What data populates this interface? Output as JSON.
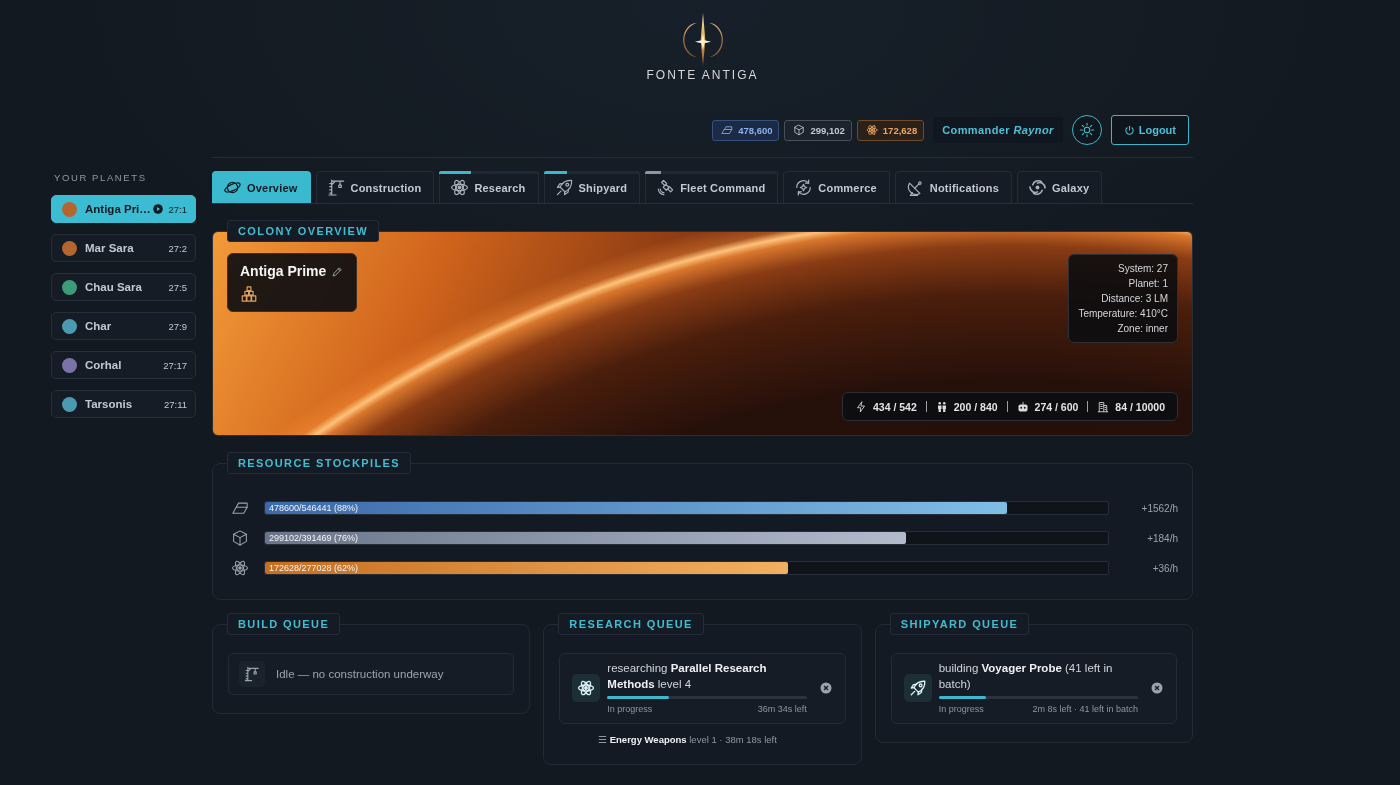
{
  "brand": {
    "name": "FONTE ANTIGA"
  },
  "resources": [
    {
      "kind": "ingot",
      "value": "478,600"
    },
    {
      "kind": "cube",
      "value": "299,102"
    },
    {
      "kind": "atom",
      "value": "172,628"
    }
  ],
  "user": {
    "text": "Commander *Raynor*"
  },
  "logout": {
    "label": "Logout"
  },
  "sidebar": {
    "title": "YOUR PLANETS",
    "planets": [
      {
        "name": "Antiga Pri…",
        "coords": "27:1",
        "color": "#b5652f",
        "selected": true,
        "active": true
      },
      {
        "name": "Mar Sara",
        "coords": "27:2",
        "color": "#b5652f",
        "selected": false,
        "active": false
      },
      {
        "name": "Chau Sara",
        "coords": "27:5",
        "color": "#3e9a78",
        "selected": false,
        "active": false
      },
      {
        "name": "Char",
        "coords": "27:9",
        "color": "#4a9bb0",
        "selected": false,
        "active": false
      },
      {
        "name": "Corhal",
        "coords": "27:17",
        "color": "#7b72a6",
        "selected": false,
        "active": false
      },
      {
        "name": "Tarsonis",
        "coords": "27:11",
        "color": "#4a9bb0",
        "selected": false,
        "active": false
      }
    ]
  },
  "tabs": [
    {
      "kind": "planet",
      "label": "Overview",
      "selected": true
    },
    {
      "kind": "crane",
      "label": "Construction",
      "selected": false
    },
    {
      "kind": "atom",
      "label": "Research",
      "selected": false,
      "level": 0.32,
      "color": "#3bb8cc"
    },
    {
      "kind": "rocket",
      "label": "Shipyard",
      "selected": false,
      "level": 0.24,
      "color": "#3bb8cc"
    },
    {
      "kind": "satellite",
      "label": "Fleet Command",
      "selected": false,
      "level": 0.12,
      "color": "#8c96a2"
    },
    {
      "kind": "cycle",
      "label": "Commerce",
      "selected": false
    },
    {
      "kind": "dish",
      "label": "Notifications",
      "selected": false
    },
    {
      "kind": "swirl",
      "label": "Galaxy",
      "selected": false
    }
  ],
  "colony": {
    "heading": "COLONY OVERVIEW",
    "name": "Antiga Prime",
    "details": [
      "System: 27",
      "Planet: 1",
      "Distance: 3 LM",
      "Temperature: 410°C",
      "Zone: inner"
    ],
    "stats": [
      {
        "kind": "bolt",
        "value": "434 / 542"
      },
      {
        "kind": "people",
        "value": "200 / 840"
      },
      {
        "kind": "robot",
        "value": "274 / 600"
      },
      {
        "kind": "building",
        "value": "84 / 10000"
      }
    ]
  },
  "stockpiles": {
    "heading": "RESOURCE STOCKPILES",
    "rows": [
      {
        "kind": "ingot",
        "amount": "478600/546441 (88%)",
        "level": 0.88,
        "rate": "+1562/h"
      },
      {
        "kind": "cube",
        "amount": "299102/391469 (76%)",
        "level": 0.76,
        "rate": "+184/h"
      },
      {
        "kind": "atom",
        "amount": "172628/277028 (62%)",
        "level": 0.62,
        "rate": "+36/h"
      }
    ]
  },
  "queues": [
    {
      "kind": "crane",
      "heading": "BUILD QUEUE",
      "idle": "Idle — no construction underway"
    },
    {
      "kind": "atom",
      "heading": "RESEARCH QUEUE",
      "current": {
        "text": "researching **Parallel Research Methods** level 4",
        "status": "In progress",
        "remaining": "36m 34s left",
        "level": 0.31
      },
      "next": "☰ **Energy Weapons** level 1 · 38m 18s left"
    },
    {
      "kind": "rocket",
      "heading": "SHIPYARD QUEUE",
      "current": {
        "text": "building **Voyager Probe** (41 left in batch)",
        "status": "In progress",
        "remaining": "2m 8s left · 41 left in batch",
        "level": 0.24
      }
    }
  ]
}
